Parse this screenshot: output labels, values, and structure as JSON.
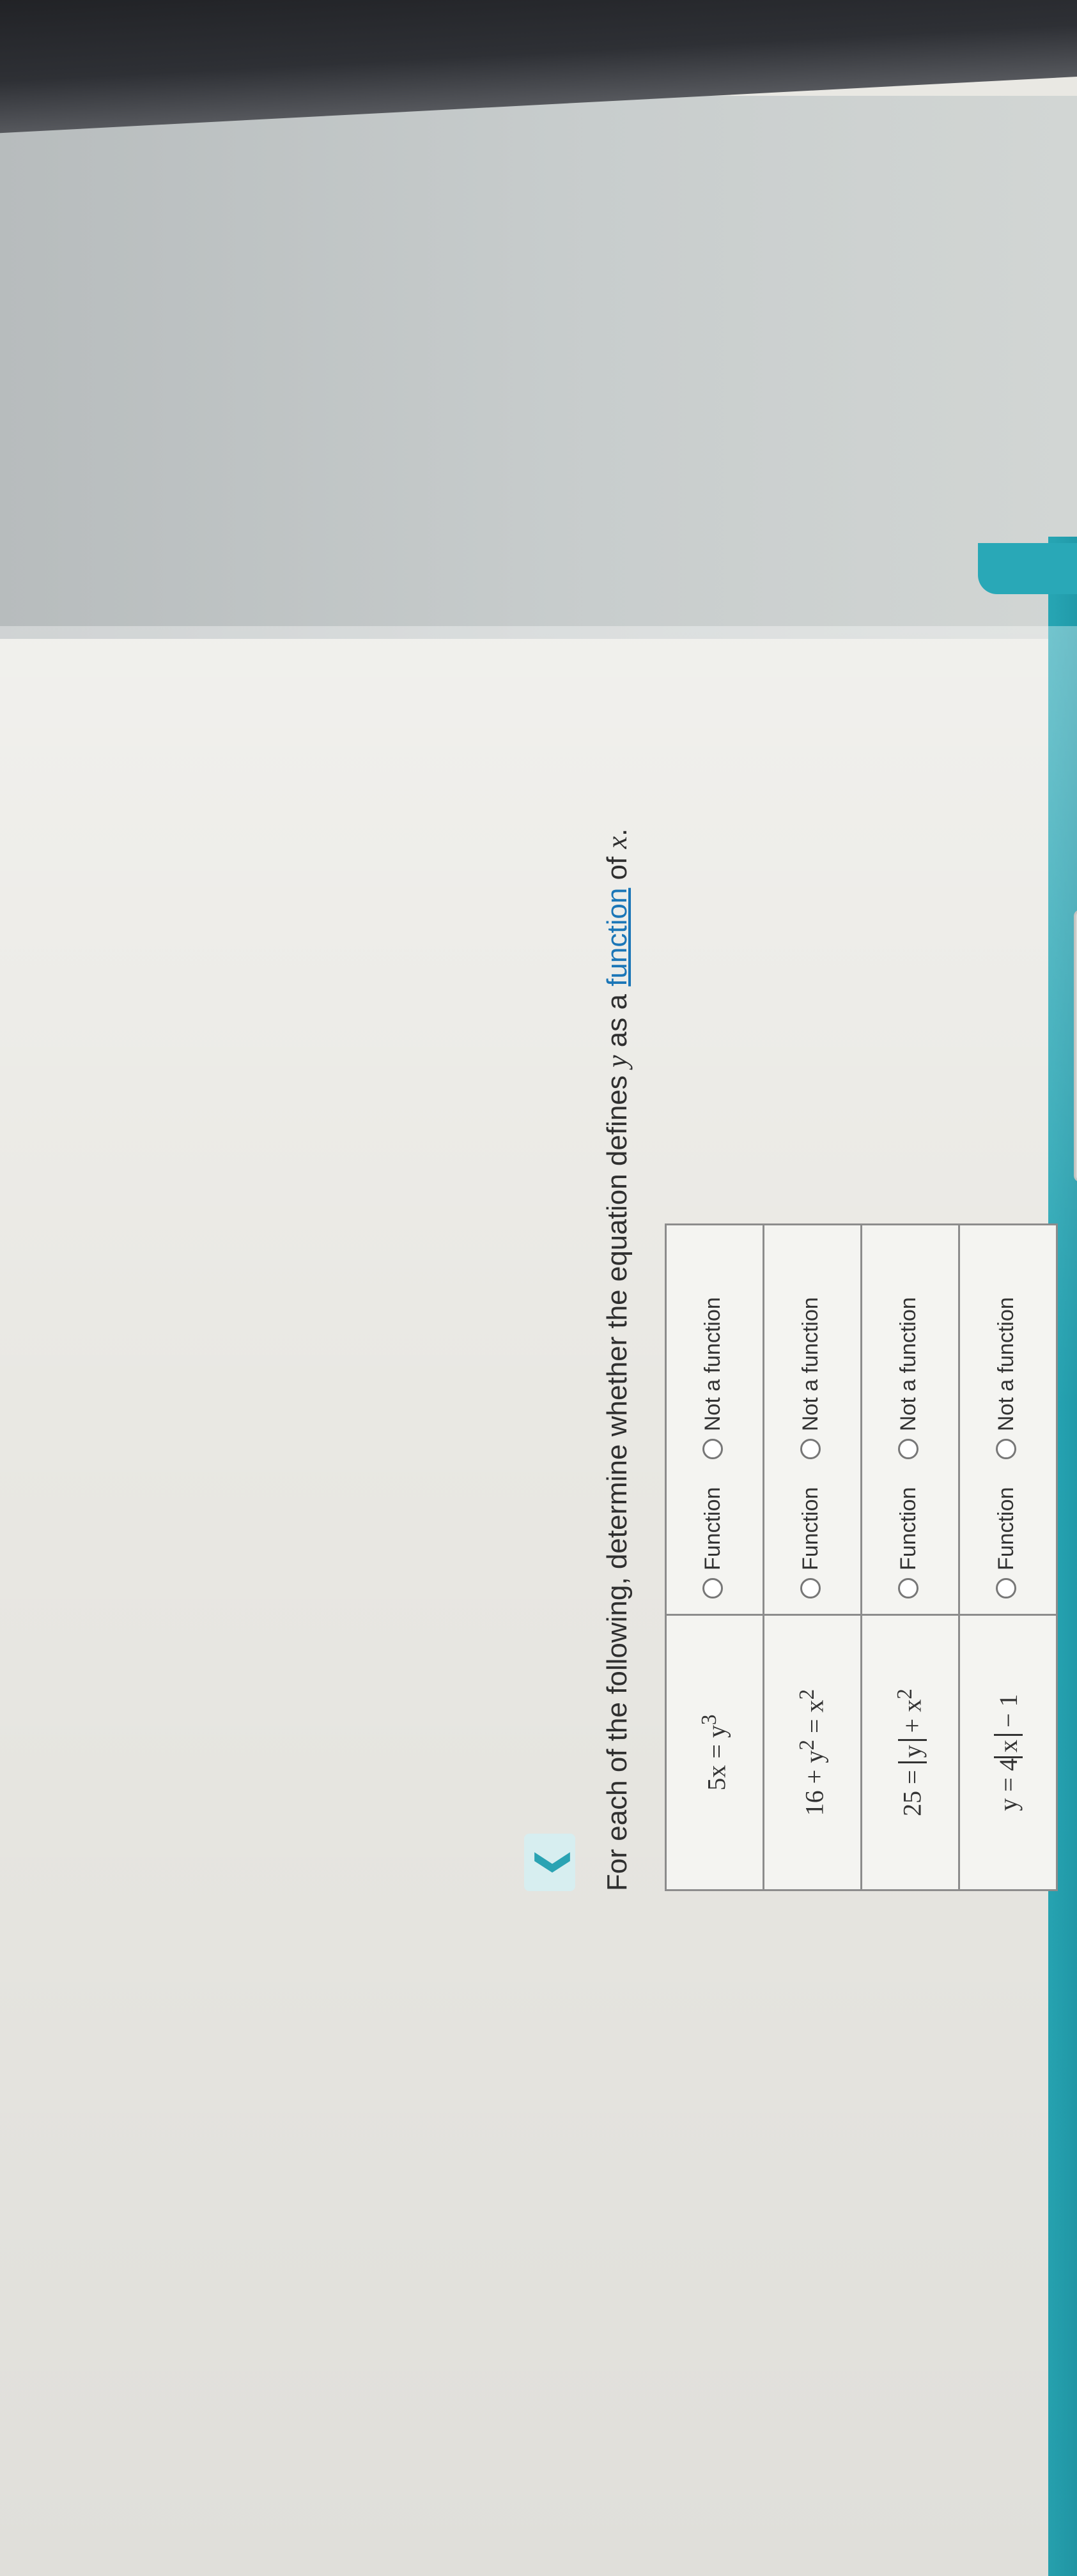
{
  "nav": {
    "back_icon": "chevron-left-icon",
    "back_glyph": "❮"
  },
  "prompt": {
    "before": "For each of the following, determine whether the equation defines ",
    "y": "y",
    "mid": " as a ",
    "link": "function",
    "after": " of ",
    "x": "x",
    "end": "."
  },
  "rows": [
    {
      "equation": [
        "5x = y",
        "3"
      ],
      "options": [
        "Function",
        "Not a function"
      ]
    },
    {
      "equation": [
        "16 + y",
        "2",
        " = x",
        "2"
      ],
      "options": [
        "Function",
        "Not a function"
      ]
    },
    {
      "equation": [
        "25 = ",
        "y",
        " + x",
        "2"
      ],
      "options": [
        "Function",
        "Not a function"
      ]
    },
    {
      "equation": [
        "y = 4",
        "x",
        " − 1"
      ],
      "options": [
        "Function",
        "Not a function"
      ]
    }
  ],
  "actions": {
    "clear": "×",
    "undo": "↺"
  },
  "colors": {
    "accent": "#29a8b7",
    "link": "#1b76b7"
  }
}
